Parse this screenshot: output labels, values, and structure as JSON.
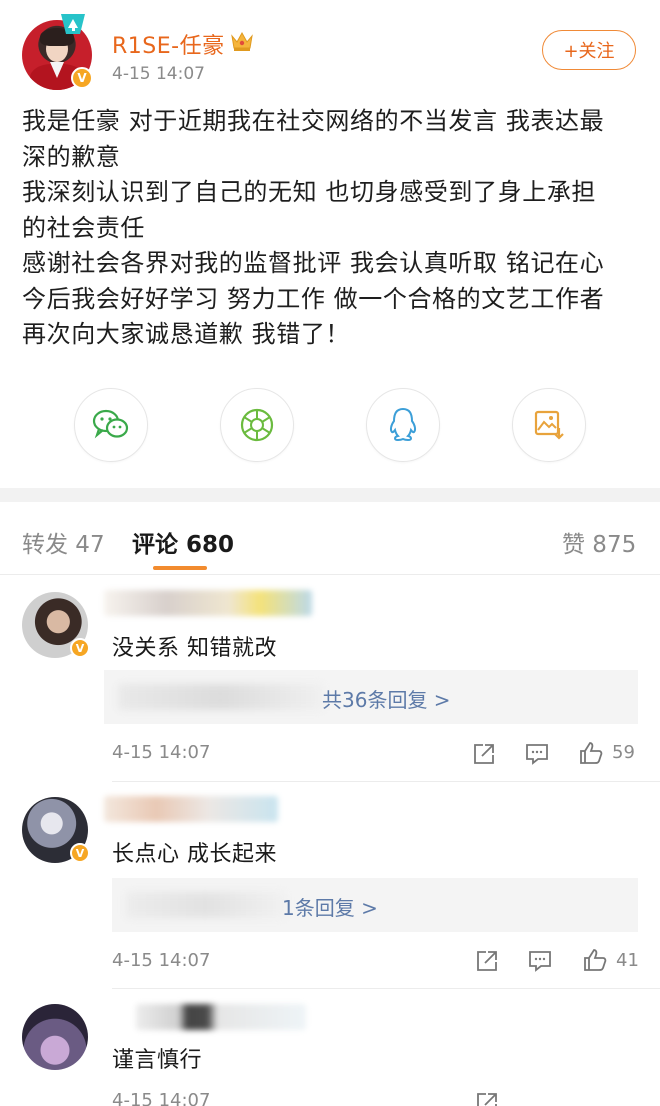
{
  "post": {
    "user_name": "R1SE-任豪",
    "time": "4-15 14:07",
    "follow_label": "+关注",
    "lines": [
      "我是任豪 对于近期我在社交网络的不当发言 我表达最",
      "深的歉意",
      "我深刻认识到了自己的无知 也切身感受到了身上承担",
      "的社会责任",
      "感谢社会各界对我的监督批评 我会认真听取 铭记在心",
      "今后我会好好学习 努力工作 做一个合格的文艺工作者",
      "再次向大家诚恳道歉 我错了！"
    ]
  },
  "share": {
    "icons": [
      "wechat-icon",
      "moments-icon",
      "qq-icon",
      "save-image-icon"
    ]
  },
  "tabs": {
    "repost": "转发 47",
    "comments": "评论 680",
    "likes": "赞 875"
  },
  "comments": [
    {
      "text": "没关系 知错就改",
      "reply_link": "共36条回复 >",
      "time": "4-15 14:07",
      "likes": "59"
    },
    {
      "text": "长点心 成长起来",
      "reply_link": "1条回复 >",
      "time": "4-15 14:07",
      "likes": "41"
    },
    {
      "text": "谨言慎行",
      "time": "4-15 14:07"
    }
  ],
  "colors": {
    "accent": "#e8671c",
    "link": "#5d7aa8",
    "muted": "#8a8a8a",
    "tab_underline": "#f28b2e"
  }
}
